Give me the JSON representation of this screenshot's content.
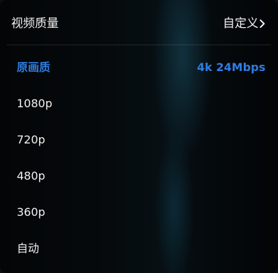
{
  "header": {
    "title": "视频质量",
    "setting_label": "自定义"
  },
  "colors": {
    "accent": "#2f7de1",
    "text": "#f2f2f2"
  },
  "icons": {
    "header_chevron": "chevron-right-icon"
  },
  "quality_options": [
    {
      "label": "原画质",
      "detail": "4k 24Mbps",
      "selected": true
    },
    {
      "label": "1080p",
      "detail": "",
      "selected": false
    },
    {
      "label": "720p",
      "detail": "",
      "selected": false
    },
    {
      "label": "480p",
      "detail": "",
      "selected": false
    },
    {
      "label": "360p",
      "detail": "",
      "selected": false
    },
    {
      "label": "自动",
      "detail": "",
      "selected": false
    }
  ]
}
